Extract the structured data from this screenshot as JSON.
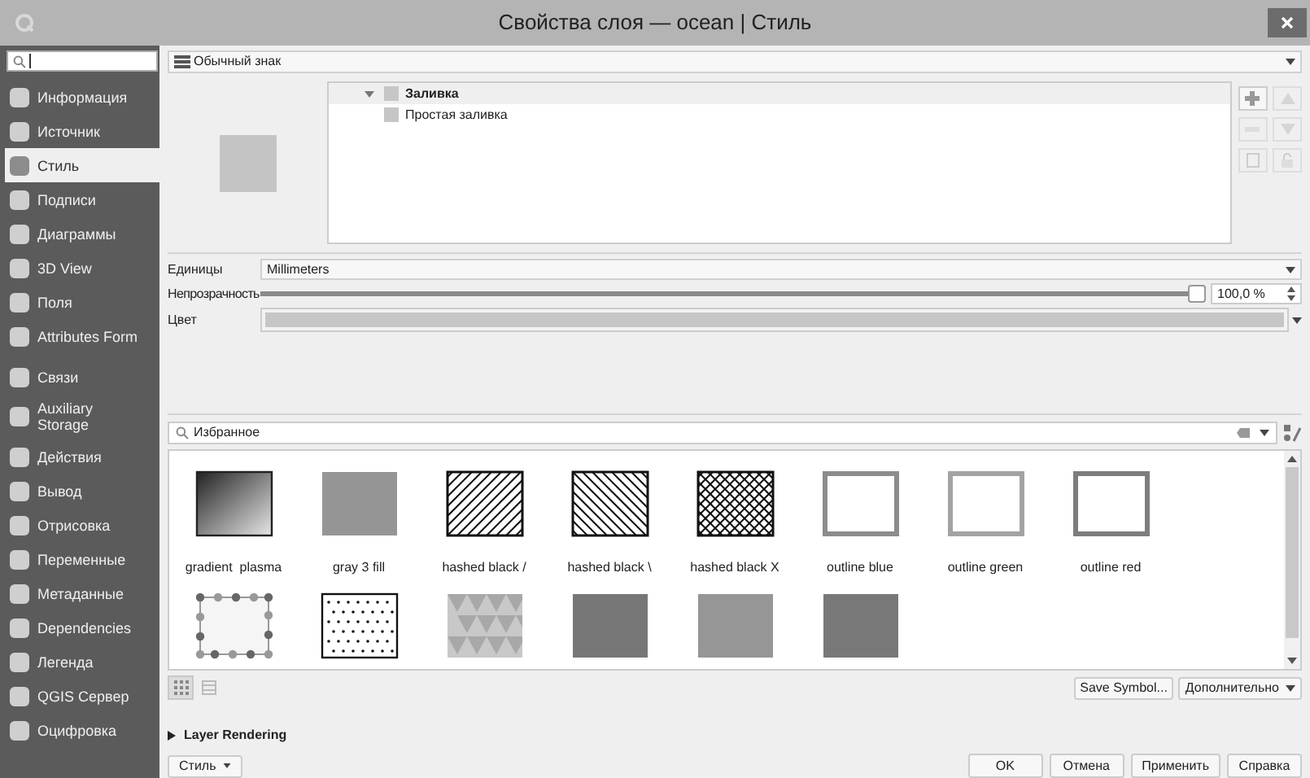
{
  "window": {
    "title": "Свойства слоя — ocean | Стиль"
  },
  "sidebar": {
    "items": [
      {
        "label": "Информация",
        "selected": false
      },
      {
        "label": "Источник",
        "selected": false
      },
      {
        "label": "Стиль",
        "selected": true
      },
      {
        "label": "Подписи",
        "selected": false
      },
      {
        "label": "Диаграммы",
        "selected": false
      },
      {
        "label": "3D View",
        "selected": false
      },
      {
        "label": "Поля",
        "selected": false
      },
      {
        "label": "Attributes Form",
        "selected": false
      },
      {
        "label": "Связи",
        "selected": false
      },
      {
        "label": "Auxiliary Storage",
        "selected": false
      },
      {
        "label": "Действия",
        "selected": false
      },
      {
        "label": "Вывод",
        "selected": false
      },
      {
        "label": "Отрисовка",
        "selected": false
      },
      {
        "label": "Переменные",
        "selected": false
      },
      {
        "label": "Метаданные",
        "selected": false
      },
      {
        "label": "Dependencies",
        "selected": false
      },
      {
        "label": "Легенда",
        "selected": false
      },
      {
        "label": "QGIS Сервер",
        "selected": false
      },
      {
        "label": "Оцифровка",
        "selected": false
      }
    ]
  },
  "renderer": {
    "value": "Обычный знак"
  },
  "symbol_tree": [
    {
      "label": "Заливка",
      "expanded": true,
      "children": [
        {
          "label": "Простая заливка"
        }
      ]
    }
  ],
  "form": {
    "units_label": "Единицы",
    "units": "Millimeters",
    "opacity_label": "Непрозрачность",
    "opacity": {
      "level": 1,
      "reading": "100,0 %"
    },
    "color_label": "Цвет"
  },
  "library": {
    "search": {
      "value": "Избранное"
    },
    "symbols": [
      {
        "kind": "gradient",
        "label": "gradient  plasma"
      },
      {
        "kind": "fill",
        "label": "gray 3 fill",
        "color": "#959595"
      },
      {
        "kind": "hatch-forward",
        "label": "hashed black /"
      },
      {
        "kind": "hatch-back",
        "label": "hashed black \\"
      },
      {
        "kind": "hatch-cross",
        "label": "hashed black X"
      },
      {
        "kind": "outline",
        "label": "outline blue",
        "color": "#8c8c8c"
      },
      {
        "kind": "outline",
        "label": "outline green",
        "color": "#a3a3a3"
      },
      {
        "kind": "outline",
        "label": "outline red",
        "color": "#7d7d7d"
      },
      {
        "kind": "dot-border"
      },
      {
        "kind": "dots"
      },
      {
        "kind": "triangles"
      },
      {
        "kind": "fill",
        "color": "#777777"
      },
      {
        "kind": "fill",
        "color": "#969696"
      },
      {
        "kind": "fill",
        "color": "#787878"
      }
    ],
    "save_button": "Save Symbol...",
    "advanced_button": "Дополнительно"
  },
  "sections": [
    {
      "label": "Layer Rendering",
      "expanded": false
    }
  ],
  "footer": {
    "style_menu": "Стиль",
    "buttons": [
      "OK",
      "Отмена",
      "Применить",
      "Справка"
    ]
  }
}
